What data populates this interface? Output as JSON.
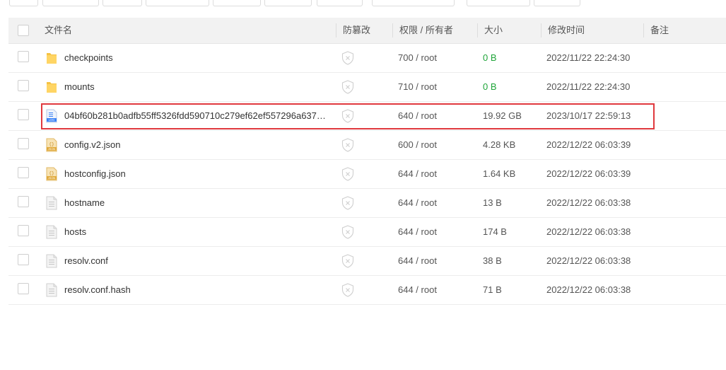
{
  "table": {
    "headers": {
      "filename": "文件名",
      "tamper": "防篡改",
      "perm_owner": "权限 / 所有者",
      "size": "大小",
      "mtime": "修改时间",
      "note": "备注"
    },
    "rows": [
      {
        "icon": "folder-icon",
        "name": "checkpoints",
        "perm": "700 / root",
        "size": "0 B",
        "size_color": "#20a53a",
        "time": "2022/11/22 22:24:30"
      },
      {
        "icon": "folder-icon",
        "name": "mounts",
        "perm": "710 / root",
        "size": "0 B",
        "size_color": "#20a53a",
        "time": "2022/11/22 22:24:30"
      },
      {
        "icon": "log-file-icon",
        "name": "04bf60b281b0adfb55ff5326fdd590710c279ef62ef557296a637c…",
        "perm": "640 / root",
        "size": "19.92 GB",
        "time": "2023/10/17 22:59:13"
      },
      {
        "icon": "json-file-icon",
        "name": "config.v2.json",
        "perm": "600 / root",
        "size": "4.28 KB",
        "time": "2022/12/22 06:03:39"
      },
      {
        "icon": "json-file-icon",
        "name": "hostconfig.json",
        "perm": "644 / root",
        "size": "1.64 KB",
        "time": "2022/12/22 06:03:39"
      },
      {
        "icon": "text-file-icon",
        "name": "hostname",
        "perm": "644 / root",
        "size": "13 B",
        "time": "2022/12/22 06:03:38"
      },
      {
        "icon": "text-file-icon",
        "name": "hosts",
        "perm": "644 / root",
        "size": "174 B",
        "time": "2022/12/22 06:03:38"
      },
      {
        "icon": "text-file-icon",
        "name": "resolv.conf",
        "perm": "644 / root",
        "size": "38 B",
        "time": "2022/12/22 06:03:38"
      },
      {
        "icon": "text-file-icon",
        "name": "resolv.conf.hash",
        "perm": "644 / root",
        "size": "71 B",
        "time": "2022/12/22 06:03:38"
      }
    ]
  },
  "highlight": {
    "color": "#e0393e",
    "row": 2
  }
}
